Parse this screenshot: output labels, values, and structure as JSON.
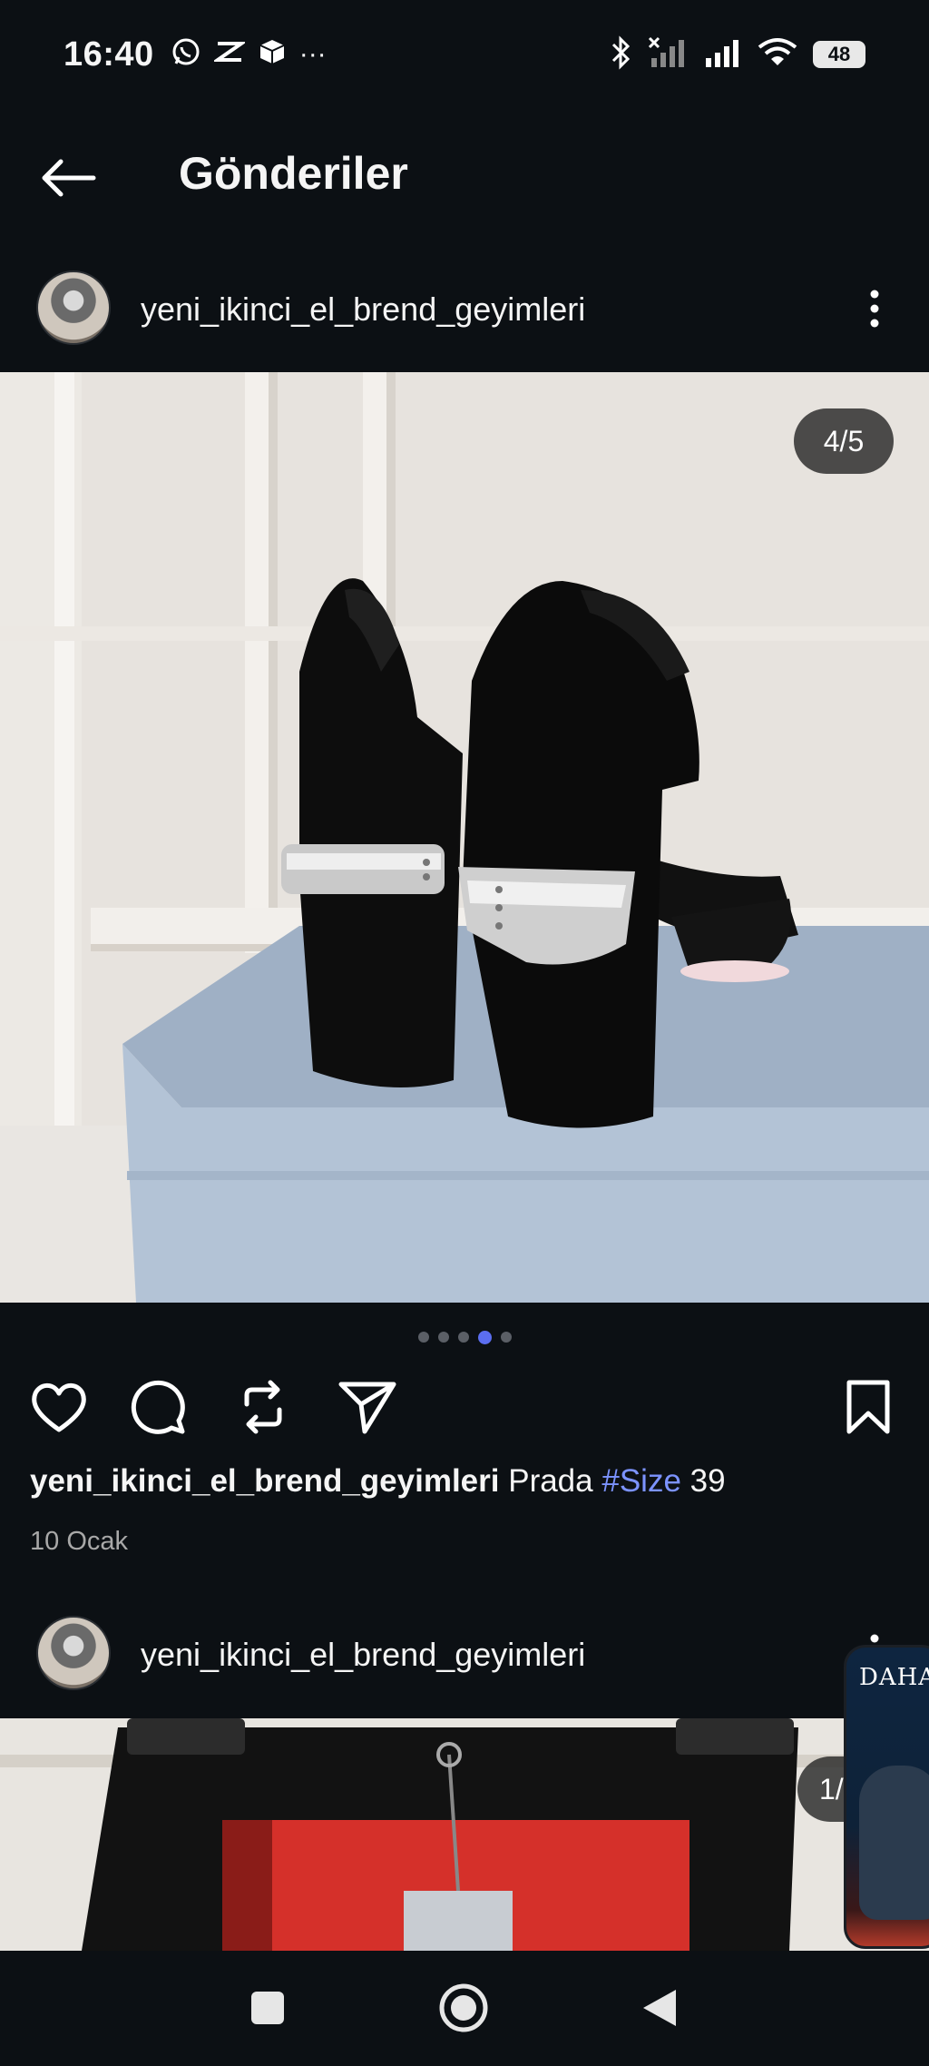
{
  "status_bar": {
    "time": "16:40",
    "left_icons": [
      "whatsapp-icon",
      "capcut-icon",
      "box-icon",
      "more-dots"
    ],
    "overflow": "···",
    "battery": "48"
  },
  "header": {
    "title": "Gönderiler"
  },
  "posts": [
    {
      "username": "yeni_ikinci_el_brend_geyimleri",
      "counter": "4/5",
      "dots_total": 5,
      "dots_active_index": 3,
      "caption": {
        "user": "yeni_ikinci_el_brend_geyimleri",
        "text_before": "Prada",
        "hashtag": "#Size",
        "text_after": "39"
      },
      "date": "10 Ocak"
    },
    {
      "username": "yeni_ikinci_el_brend_geyimleri",
      "counter": "1/"
    }
  ],
  "floating_card": {
    "label": "DAHA"
  },
  "colors": {
    "background": "#0c1014",
    "hashtag": "#7c93ff",
    "dot_active": "#5b6ef0"
  }
}
